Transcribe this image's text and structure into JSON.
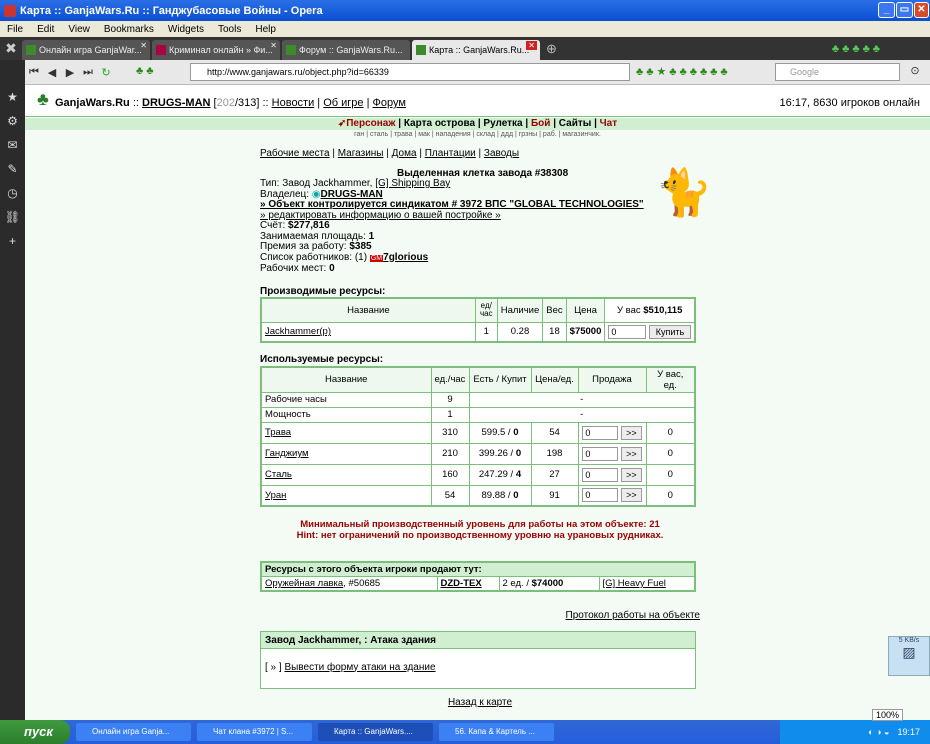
{
  "window": {
    "title": "Карта :: GanjaWars.Ru :: Ганджубасовые Войны - Opera"
  },
  "menu": [
    "File",
    "Edit",
    "View",
    "Bookmarks",
    "Widgets",
    "Tools",
    "Help"
  ],
  "tabs": [
    {
      "label": "Онлайн игра GanjaWar..."
    },
    {
      "label": "Криминал онлайн » Фи..."
    },
    {
      "label": "Форум :: GanjaWars.Ru..."
    },
    {
      "label": "Карта :: GanjaWars.Ru..."
    }
  ],
  "address": {
    "url": "http://www.ganjawars.ru/object.php?id=66339",
    "search_placeholder": "Google"
  },
  "header": {
    "site": "GanjaWars.Ru",
    "user": "DRUGS-MAN",
    "stat_a": "202",
    "stat_b": "/313]",
    "links": [
      "Новости",
      "Об игре",
      "Форум"
    ],
    "online": "16:17, 8630 игроков онлайн"
  },
  "topnav": [
    "Персонаж",
    "Карта острова",
    "Рулетка",
    "Бой",
    "Сайты",
    "Чат"
  ],
  "subnav": "ган | сталь | трава | мак | нападения | склад | ддд | грзны | раб. | магазинчик.",
  "sections": [
    "Рабочие места",
    "Магазины",
    "Дома",
    "Плантации",
    "Заводы"
  ],
  "object": {
    "title": "Выделенная клетка завода #38308",
    "type_label": "Тип: Завод Jackhammer, ",
    "type_link": "[G] Shipping Bay",
    "owner_label": "Владелец: ",
    "owner": "DRUGS-MAN",
    "syndicate": "» Объект контролируется синдикатом # 3972 ВПС \"GLOBAL TECHNOLOGIES\"",
    "edit": "» редактировать информацию о вашей постройке »",
    "account_label": "Счёт: ",
    "account": "$277,816",
    "area_label": "Занимаемая площадь: ",
    "area": "1",
    "bonus_label": "Премия за работу: ",
    "bonus": "$385",
    "workers_label": "Список работников: (1) ",
    "worker_badge": "GM",
    "worker": "7glorious",
    "slots_label": "Рабочих мест: ",
    "slots": "0"
  },
  "produced": {
    "heading": "Производимые ресурсы:",
    "cols": [
      "Название",
      "ед/\nчас",
      "Наличие",
      "Вес",
      "Цена",
      "У вас "
    ],
    "cash": "$510,115",
    "row": {
      "name": "Jackhammer(p)",
      "rate": "1",
      "stock": "0.28",
      "weight": "18",
      "price": "$75000",
      "qty": "0",
      "buy": "Купить"
    }
  },
  "used": {
    "heading": "Используемые ресурсы:",
    "cols": [
      "Название",
      "ед./час",
      "Есть / Купит",
      "Цена/ед.",
      "Продажа",
      "У вас, ед."
    ],
    "rows": [
      {
        "name": "Рабочие часы",
        "rate": "9",
        "have": "",
        "buy": "",
        "price": "",
        "sell": "-",
        "yours": "",
        "link": false
      },
      {
        "name": "Мощность",
        "rate": "1",
        "have": "",
        "buy": "",
        "price": "",
        "sell": "-",
        "yours": "",
        "link": false
      },
      {
        "name": "Трава",
        "rate": "310",
        "have": "599.5 / ",
        "buy": "0",
        "price": "54",
        "sell": "0",
        "yours": "0",
        "link": true
      },
      {
        "name": "Ганджиум",
        "rate": "210",
        "have": "399.26 / ",
        "buy": "0",
        "price": "198",
        "sell": "0",
        "yours": "0",
        "link": true
      },
      {
        "name": "Сталь",
        "rate": "160",
        "have": "247.29 / ",
        "buy": "4",
        "price": "27",
        "sell": "0",
        "yours": "0",
        "link": true
      },
      {
        "name": "Уран",
        "rate": "54",
        "have": "89.88 / ",
        "buy": "0",
        "price": "91",
        "sell": "0",
        "yours": "0",
        "link": true
      }
    ],
    "sell_btn": ">>"
  },
  "notice": {
    "line1": "Минимальный производственный уровень для работы на этом объекте: 21",
    "line2": "Hint: нет ограничений по производственному уровню на урановых рудниках."
  },
  "sold": {
    "heading": "Ресурсы с этого объекта игроки продают тут:",
    "shop": "Оружейная лавка",
    "shop_id": ", #50685",
    "seller": "DZD-TEX",
    "offer_a": "2 ед. / ",
    "offer_b": "$74000",
    "item": "[G] Heavy Fuel"
  },
  "protocol": "Протокол работы на объекте",
  "attack": {
    "title": "Завод Jackhammer, : Атака здания",
    "prefix": "[ » ] ",
    "link": "Вывести форму атаки на здание"
  },
  "back": "Назад к карте",
  "taskbar": {
    "start": "пуск",
    "items": [
      "Онлайн игра Ganja...",
      "Чат клана #3972 | S...",
      "Карта :: GanjaWars....",
      "56. Капа & Картель ..."
    ],
    "lang": "RU",
    "zoom": "100%",
    "clock": "19:17"
  },
  "widget": {
    "speed": "5 KB/s"
  },
  "colors": {
    "accent": "#7cbf7c",
    "warn": "#990000",
    "titlebar": "#0a4fd0"
  }
}
